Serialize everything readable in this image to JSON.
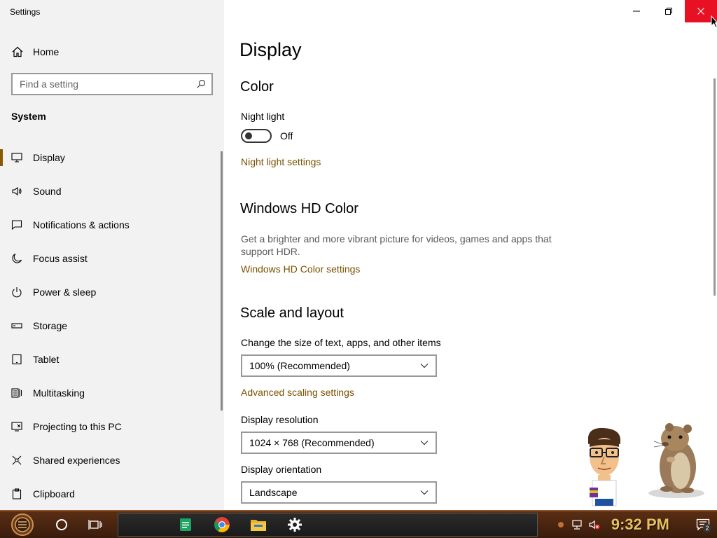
{
  "window": {
    "title": "Settings"
  },
  "sidebar": {
    "home_label": "Home",
    "search_placeholder": "Find a setting",
    "section": "System",
    "items": [
      {
        "label": "Display",
        "icon": "monitor-icon",
        "active": true
      },
      {
        "label": "Sound",
        "icon": "speaker-icon"
      },
      {
        "label": "Notifications & actions",
        "icon": "notification-icon"
      },
      {
        "label": "Focus assist",
        "icon": "moon-icon"
      },
      {
        "label": "Power & sleep",
        "icon": "power-icon"
      },
      {
        "label": "Storage",
        "icon": "storage-icon"
      },
      {
        "label": "Tablet",
        "icon": "tablet-icon"
      },
      {
        "label": "Multitasking",
        "icon": "multitasking-icon"
      },
      {
        "label": "Projecting to this PC",
        "icon": "projector-icon"
      },
      {
        "label": "Shared experiences",
        "icon": "shared-icon"
      },
      {
        "label": "Clipboard",
        "icon": "clipboard-icon"
      }
    ]
  },
  "main": {
    "title": "Display",
    "color": {
      "heading": "Color",
      "night_light_label": "Night light",
      "night_light_state": "Off",
      "night_light_link": "Night light settings"
    },
    "hdr": {
      "heading": "Windows HD Color",
      "description": "Get a brighter and more vibrant picture for videos, games and apps that support HDR.",
      "link": "Windows HD Color settings"
    },
    "scale": {
      "heading": "Scale and layout",
      "size_label": "Change the size of text, apps, and other items",
      "size_value": "100% (Recommended)",
      "advanced_link": "Advanced scaling settings",
      "resolution_label": "Display resolution",
      "resolution_value": "1024 × 768 (Recommended)",
      "orientation_label": "Display orientation",
      "orientation_value": "Landscape"
    }
  },
  "taskbar": {
    "clock": "9:32 PM",
    "notification_count": "2",
    "apps": [
      "sheets-icon",
      "chrome-icon",
      "file-explorer-icon",
      "settings-gear-icon"
    ]
  },
  "colors": {
    "accent": "#8a5a00",
    "link": "#7a5200",
    "close_button": "#e81123",
    "sidebar_bg": "#f2f2f2",
    "taskbar": "#4a2412"
  }
}
